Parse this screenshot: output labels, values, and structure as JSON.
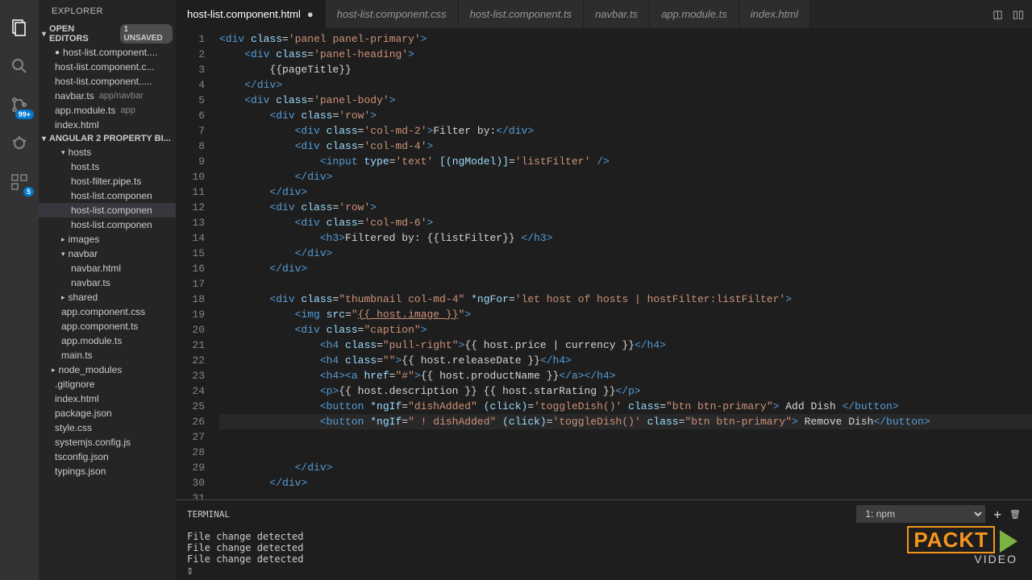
{
  "explorer_title": "EXPLORER",
  "open_editors_label": "OPEN EDITORS",
  "unsaved_label": "1 UNSAVED",
  "project_section": "ANGULAR 2 PROPERTY BI...",
  "open_editors": [
    {
      "name": "host-list.component....",
      "modified": true
    },
    {
      "name": "host-list.component.c..."
    },
    {
      "name": "host-list.component....."
    },
    {
      "name": "navbar.ts",
      "meta": "app/navbar"
    },
    {
      "name": "app.module.ts",
      "meta": "app"
    },
    {
      "name": "index.html"
    }
  ],
  "tree": {
    "hosts_folder": "hosts",
    "hosts_files": [
      "host.ts",
      "host-filter.pipe.ts",
      "host-list.componen",
      "host-list.componen",
      "host-list.componen"
    ],
    "active_index": 3,
    "images_folder": "images",
    "navbar_folder": "navbar",
    "navbar_files": [
      "navbar.html",
      "navbar.ts"
    ],
    "shared_folder": "shared",
    "root_files": [
      "app.component.css",
      "app.component.ts",
      "app.module.ts",
      "main.ts"
    ],
    "node_modules": "node_modules",
    "bottom_files": [
      ".gitignore",
      "index.html",
      "package.json",
      "style.css",
      "systemjs.config.js",
      "tsconfig.json",
      "typings.json"
    ]
  },
  "tabs": [
    {
      "label": "host-list.component.html",
      "active": true,
      "modified": true
    },
    {
      "label": "host-list.component.css"
    },
    {
      "label": "host-list.component.ts"
    },
    {
      "label": "navbar.ts"
    },
    {
      "label": "app.module.ts"
    },
    {
      "label": "index.html"
    }
  ],
  "line_count": 31,
  "terminal_label": "TERMINAL",
  "terminal_select": "1: npm",
  "terminal_lines": [
    "File change detected",
    "File change detected",
    "File change detected"
  ],
  "watermark": {
    "brand": "PACKT",
    "sub": "VIDEO"
  },
  "badges": {
    "scm": "99+",
    "debug": "5"
  }
}
